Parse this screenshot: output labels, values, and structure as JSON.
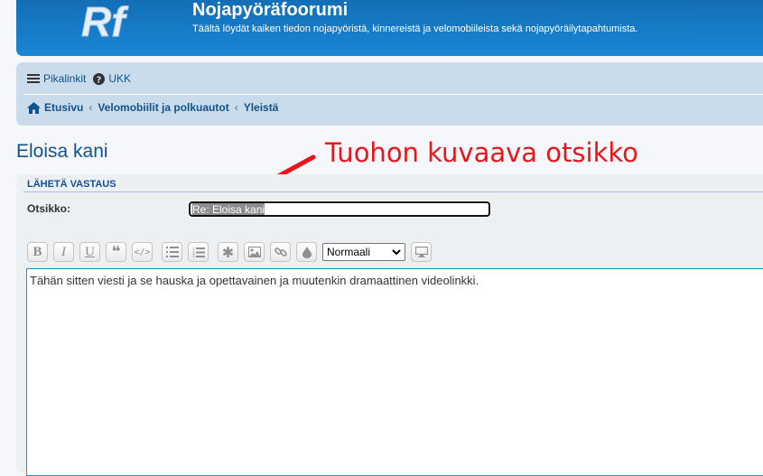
{
  "header": {
    "site_title": "Nojapyöräfoorumi",
    "site_description": "Täältä löydät kaiken tiedon nojapyöristä, kinnereistä ja velomobiileista sekä nojapyöräilytapahtumista."
  },
  "navbar": {
    "quick_links_label": "Pikalinkit",
    "faq_label": "UKK",
    "breadcrumbs": [
      "Etusivu",
      "Velomobiilit ja polkuautot",
      "Yleistä"
    ]
  },
  "page": {
    "title": "Eloisa kani"
  },
  "annotation": {
    "text": "Tuohon kuvaava otsikko",
    "color": "#e8161c"
  },
  "form": {
    "heading": "LÄHETÄ VASTAUS",
    "subject_label": "Otsikko:",
    "subject_value": "Re: Eloisa kani",
    "font_size_value": "Normaali",
    "message_text": "Tähän sitten viesti ja se hauska ja opettavainen ja muutenkin dramaattinen videolinkki."
  },
  "toolbar": {
    "buttons": [
      "bold-icon",
      "italic-icon",
      "underline-icon",
      "quote-icon",
      "code-icon",
      "list-icon",
      "numbered-list-icon",
      "asterisk-icon",
      "image-icon",
      "link-icon",
      "color-icon",
      "preview-icon"
    ]
  },
  "colors": {
    "header_blue": "#1a86d6",
    "link_blue": "#105289",
    "navbar_bg": "#cadceb",
    "panel_bg": "#ecf0f3"
  }
}
